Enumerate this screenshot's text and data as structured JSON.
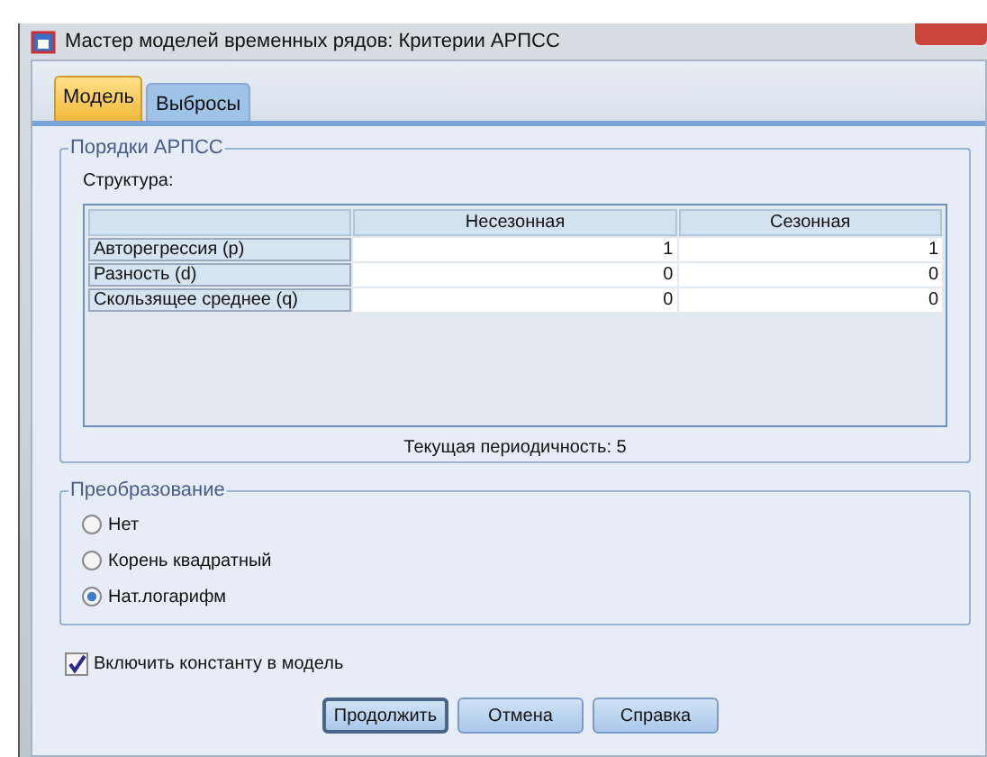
{
  "window": {
    "title": "Мастер моделей временных рядов: Критерии АРПСС"
  },
  "tabs": [
    {
      "label": "Модель",
      "selected": true
    },
    {
      "label": "Выбросы",
      "selected": false
    }
  ],
  "arima_orders": {
    "title": "Порядки АРПСС",
    "structure_label": "Структура:",
    "columns": [
      "Несезонная",
      "Сезонная"
    ],
    "rows": [
      {
        "label": "Авторегрессия (p)",
        "values": [
          "1",
          "1"
        ]
      },
      {
        "label": "Разность (d)",
        "values": [
          "0",
          "0"
        ]
      },
      {
        "label": "Скользящее среднее (q)",
        "values": [
          "0",
          "0"
        ]
      }
    ],
    "periodicity": "Текущая периодичность: 5"
  },
  "transformation": {
    "title": "Преобразование",
    "options": [
      {
        "label": "Нет",
        "selected": false
      },
      {
        "label": "Корень квадратный",
        "selected": false
      },
      {
        "label": "Нат.логарифм",
        "selected": true
      }
    ]
  },
  "include_constant": {
    "label": "Включить константу в модель",
    "checked": true
  },
  "buttons": [
    {
      "label": "Продолжить",
      "default": true
    },
    {
      "label": "Отмена",
      "default": false
    },
    {
      "label": "Справка",
      "default": false
    }
  ]
}
